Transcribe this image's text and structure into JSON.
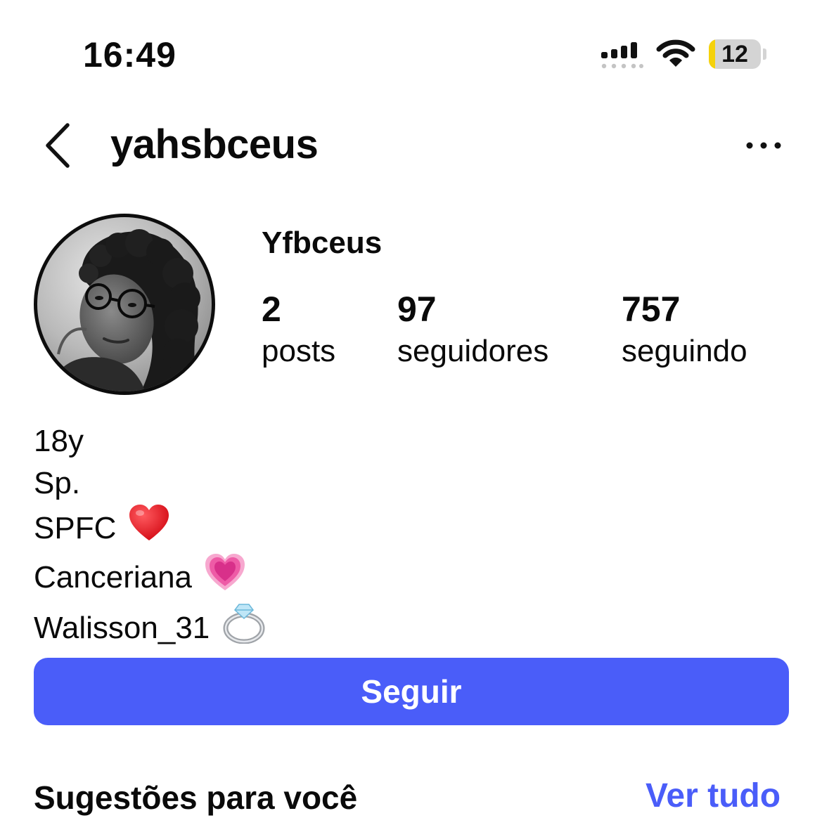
{
  "status_bar": {
    "time": "16:49",
    "battery_level": "12",
    "battery_fraction": 0.12
  },
  "header": {
    "username": "yahsbceus",
    "back_icon": "chevron-left-icon",
    "more_icon": "ellipsis-icon"
  },
  "profile": {
    "display_name": "Yfbceus",
    "stats": [
      {
        "value": "2",
        "label": "posts"
      },
      {
        "value": "97",
        "label": "seguidores"
      },
      {
        "value": "757",
        "label": "seguindo"
      }
    ],
    "bio": [
      {
        "text": "18y",
        "emoji": ""
      },
      {
        "text": "Sp.",
        "emoji": ""
      },
      {
        "text": "SPFC",
        "emoji": "red-heart"
      },
      {
        "text": "Canceriana",
        "emoji": "growing-heart"
      },
      {
        "text": "Walisson_31",
        "emoji": "ring"
      }
    ]
  },
  "actions": {
    "follow_label": "Seguir"
  },
  "suggestions": {
    "title": "Sugestões para você",
    "see_all_label": "Ver tudo"
  },
  "colors": {
    "accent": "#4a5df9",
    "battery_low": "#f5d20b",
    "text": "#0a0a0a",
    "heart_red": "#e8101d",
    "heart_pink": "#f05aa8"
  }
}
